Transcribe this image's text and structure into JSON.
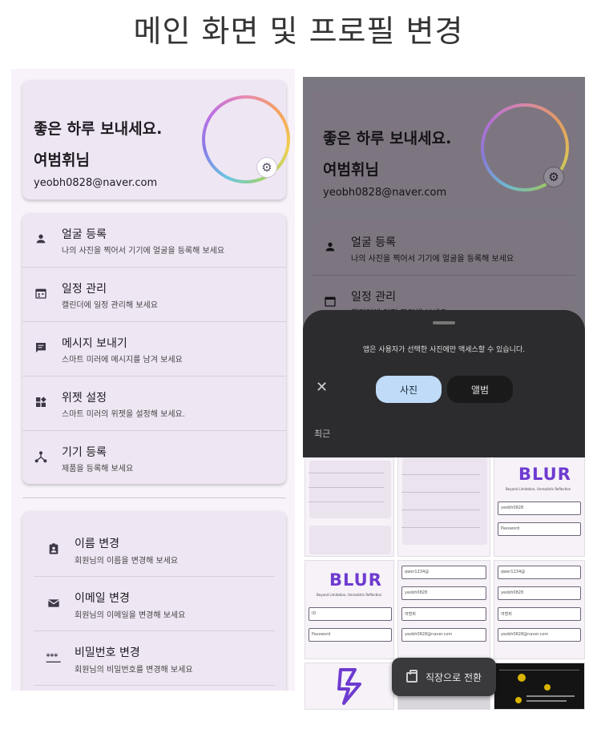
{
  "title": "메인 화면 및 프로필 변경",
  "profile": {
    "greeting": "좋은 하루 보내세요.",
    "name": "여범휘님",
    "email": "yeobh0828@naver.com"
  },
  "menu": [
    {
      "icon": "person-icon",
      "title": "얼굴 등록",
      "subtitle": "나의 사진을 찍어서 기기에 얼굴을 등록해 보세요"
    },
    {
      "icon": "calendar-icon",
      "title": "일정 관리",
      "subtitle": "캘린더에 일정 관리해 보세요"
    },
    {
      "icon": "message-icon",
      "title": "메시지 보내기",
      "subtitle": "스마트 미러에 메시지를 남겨 보세요"
    },
    {
      "icon": "widgets-icon",
      "title": "위젯 설정",
      "subtitle": "스마트 미러의 위젯을 설정해 보세요."
    },
    {
      "icon": "device-hub-icon",
      "title": "기기 등록",
      "subtitle": "제품을 등록해 보세요"
    }
  ],
  "settings": [
    {
      "icon": "badge-icon",
      "title": "이름 변경",
      "subtitle": "회원님의 이름을 변경해 보세요"
    },
    {
      "icon": "mail-icon",
      "title": "이메일 변경",
      "subtitle": "회원님의 이메일을 변경해 보세요"
    },
    {
      "icon": "password-icon",
      "title": "비밀번호 변경",
      "subtitle": "회원님의 비밀번호를 변경해 보세요"
    }
  ],
  "picker": {
    "message": "앱은 사용자가 선택한 사진에만 액세스할 수 있습니다.",
    "tab_photo": "사진",
    "tab_album": "앨범",
    "recent": "최근",
    "close_glyph": "✕"
  },
  "thumbs": {
    "blur_logo": "BLUR",
    "blur_tag": "Beyond Limitation, Unrealistic Reflection",
    "id_label": "ID",
    "password_label": "Password",
    "id_value": "yeobh0828",
    "password_value": "qwer1234@",
    "name_value": "여범휘",
    "email_value": "yeobh0828@naver.com"
  },
  "snackbar": {
    "label": "직장으로 전환"
  },
  "colors": {
    "card_bg": "#efe6f3",
    "page_bg": "#f8f3fb",
    "tab_selected_bg": "#bfdbf7",
    "sheet_bg": "#2c2c2e",
    "brand_purple": "#6e3bd0"
  }
}
